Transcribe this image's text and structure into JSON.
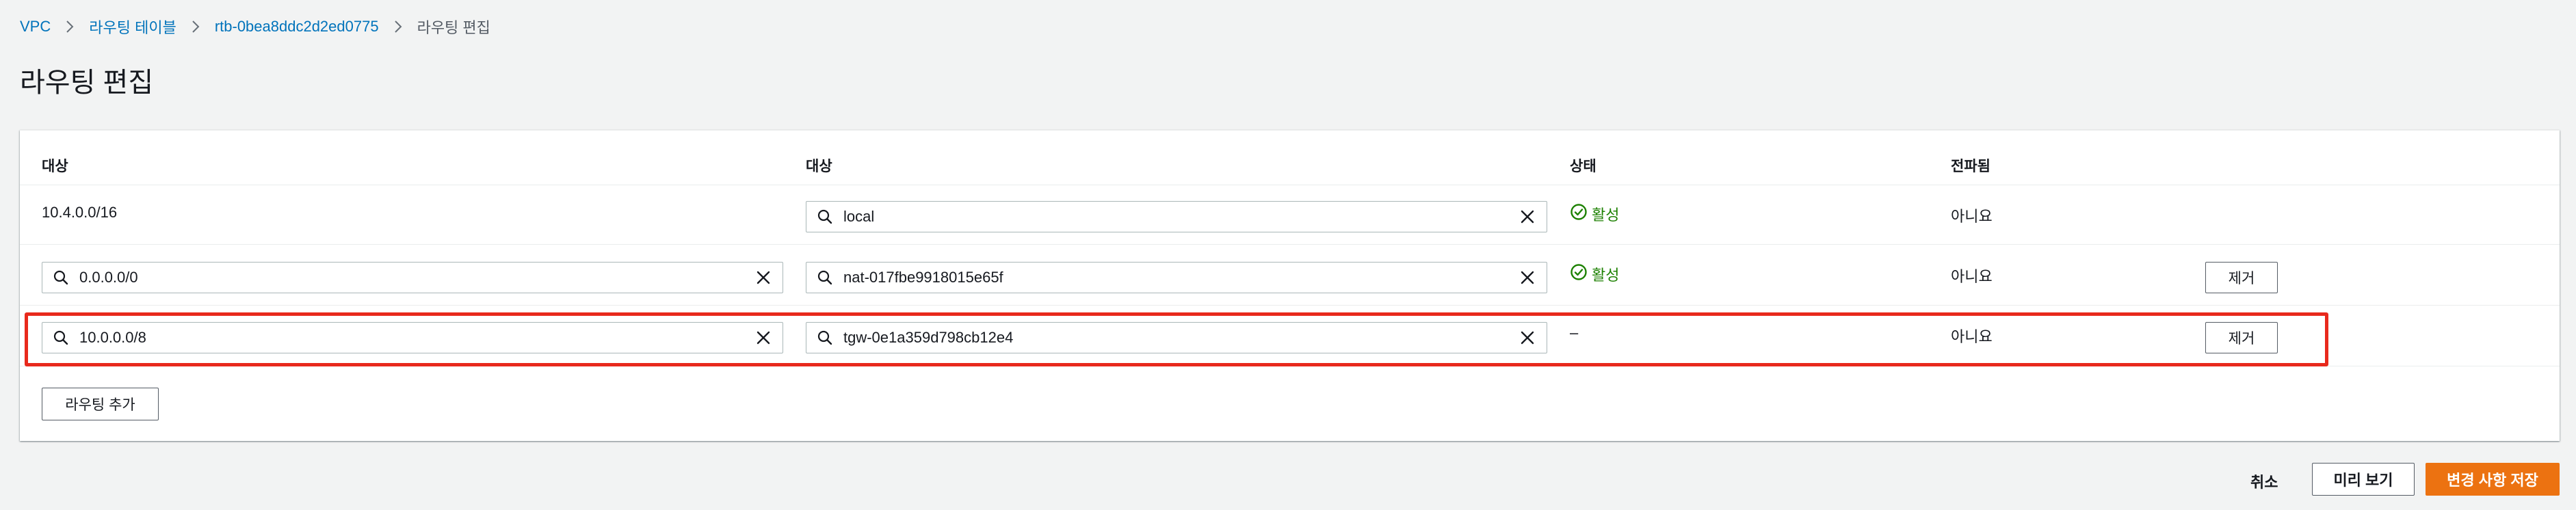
{
  "breadcrumb": {
    "vpc": "VPC",
    "route_tables": "라우팅 테이블",
    "route_table_id": "rtb-0bea8ddc2d2ed0775",
    "current": "라우팅 편집"
  },
  "page_title": "라우팅 편집",
  "table": {
    "columns": [
      "대상",
      "대상",
      "상태",
      "전파됨"
    ],
    "routes": [
      {
        "destination": "10.4.0.0/16",
        "target": "local",
        "status": "활성",
        "propagated": "아니요"
      },
      {
        "destination": "0.0.0.0/0",
        "target": "nat-017fbe9918015e65f",
        "status": "활성",
        "propagated": "아니요",
        "remove_label": "제거"
      },
      {
        "destination": "10.0.0.0/8",
        "target": "tgw-0e1a359d798cb12e4",
        "status": "–",
        "propagated": "아니요",
        "remove_label": "제거"
      }
    ],
    "add_route_label": "라우팅 추가"
  },
  "footer": {
    "cancel_label": "취소",
    "preview_label": "미리 보기",
    "save_label": "변경 사항 저장"
  },
  "colors": {
    "link": "#0073bb",
    "active_status": "#1d8102",
    "primary_button": "#ec7211",
    "highlight": "#e8291c"
  },
  "icons": [
    "chevron-right-icon",
    "search-icon",
    "clear-icon",
    "status-success-icon"
  ]
}
